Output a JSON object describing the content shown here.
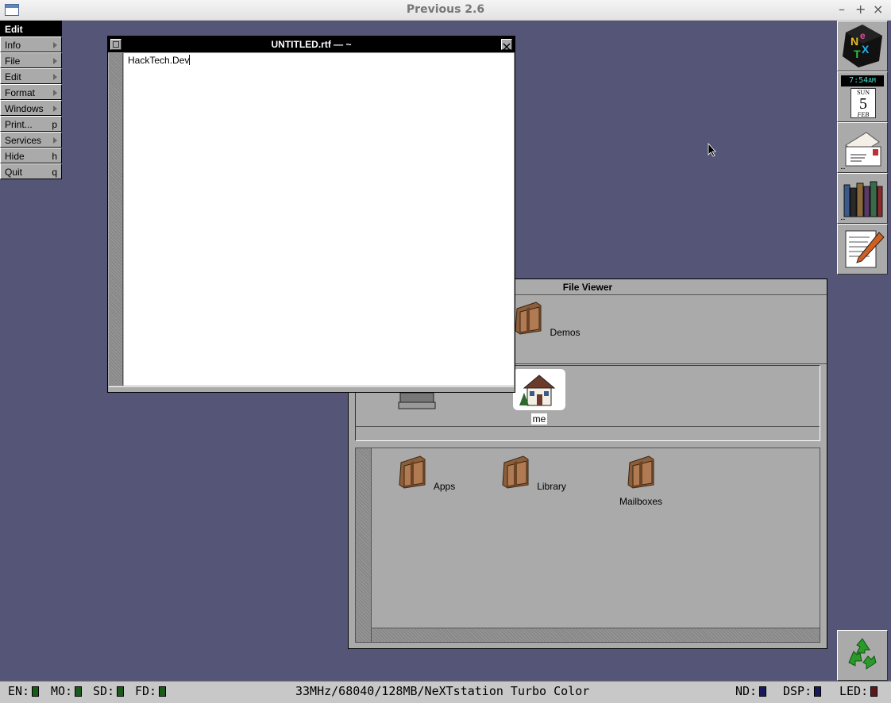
{
  "host": {
    "title": "Previous 2.6",
    "buttons": [
      "–",
      "+",
      "×"
    ]
  },
  "menu": {
    "title": "Edit",
    "items": [
      {
        "label": "Info",
        "key": ""
      },
      {
        "label": "File",
        "key": ""
      },
      {
        "label": "Edit",
        "key": ""
      },
      {
        "label": "Format",
        "key": ""
      },
      {
        "label": "Windows",
        "key": ""
      },
      {
        "label": "Print...",
        "key": "p"
      },
      {
        "label": "Services",
        "key": ""
      },
      {
        "label": "Hide",
        "key": "h"
      },
      {
        "label": "Quit",
        "key": "q"
      }
    ]
  },
  "text_window": {
    "title": "UNTITLED.rtf — ~",
    "content": "HackTech.Dev"
  },
  "file_viewer": {
    "title": "File Viewer",
    "shelf_items": [
      {
        "label": "Demos"
      }
    ],
    "path_items": [
      {
        "label": "me"
      }
    ],
    "folder_items": [
      {
        "label": "Apps"
      },
      {
        "label": "Library"
      },
      {
        "label": "Mailboxes"
      }
    ]
  },
  "dock": {
    "clock": {
      "time": "7:54",
      "ampm": "AM",
      "day": "SUN",
      "date": "5",
      "month": "FEB"
    },
    "dots": "..."
  },
  "status_bar": {
    "left": [
      {
        "label": "EN:",
        "color": "#1a5a1a"
      },
      {
        "label": "MO:",
        "color": "#1a5a1a"
      },
      {
        "label": "SD:",
        "color": "#1a5a1a"
      },
      {
        "label": "FD:",
        "color": "#1a5a1a"
      }
    ],
    "center": "33MHz/68040/128MB/NeXTstation Turbo Color",
    "right": [
      {
        "label": "ND:",
        "color": "#1a1a5a"
      },
      {
        "label": "DSP:",
        "color": "#1a1a5a"
      },
      {
        "label": "LED:",
        "color": "#5a1a1a"
      }
    ]
  },
  "colors": {
    "desktop": "#555577",
    "window_gray": "#aaaaaa",
    "title_black": "#000000"
  }
}
